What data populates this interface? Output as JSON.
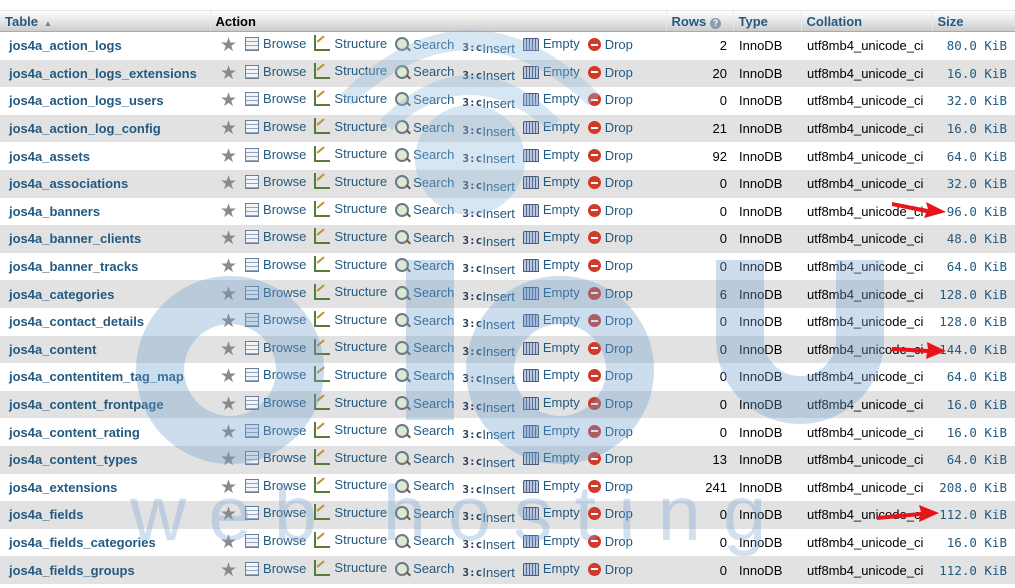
{
  "header": {
    "table_label": "Table",
    "action_label": "Action",
    "rows_label": "Rows",
    "type_label": "Type",
    "collation_label": "Collation",
    "size_label": "Size"
  },
  "actions": {
    "browse": "Browse",
    "structure": "Structure",
    "search": "Search",
    "insert": "Insert",
    "empty": "Empty",
    "drop": "Drop"
  },
  "rows": [
    {
      "name": "jos4a_action_logs",
      "rows": "2",
      "type": "InnoDB",
      "collation": "utf8mb4_unicode_ci",
      "size": "80.0 KiB"
    },
    {
      "name": "jos4a_action_logs_extensions",
      "rows": "20",
      "type": "InnoDB",
      "collation": "utf8mb4_unicode_ci",
      "size": "16.0 KiB"
    },
    {
      "name": "jos4a_action_logs_users",
      "rows": "0",
      "type": "InnoDB",
      "collation": "utf8mb4_unicode_ci",
      "size": "32.0 KiB"
    },
    {
      "name": "jos4a_action_log_config",
      "rows": "21",
      "type": "InnoDB",
      "collation": "utf8mb4_unicode_ci",
      "size": "16.0 KiB"
    },
    {
      "name": "jos4a_assets",
      "rows": "92",
      "type": "InnoDB",
      "collation": "utf8mb4_unicode_ci",
      "size": "64.0 KiB"
    },
    {
      "name": "jos4a_associations",
      "rows": "0",
      "type": "InnoDB",
      "collation": "utf8mb4_unicode_ci",
      "size": "32.0 KiB"
    },
    {
      "name": "jos4a_banners",
      "rows": "0",
      "type": "InnoDB",
      "collation": "utf8mb4_unicode_ci",
      "size": "96.0 KiB"
    },
    {
      "name": "jos4a_banner_clients",
      "rows": "0",
      "type": "InnoDB",
      "collation": "utf8mb4_unicode_ci",
      "size": "48.0 KiB"
    },
    {
      "name": "jos4a_banner_tracks",
      "rows": "0",
      "type": "InnoDB",
      "collation": "utf8mb4_unicode_ci",
      "size": "64.0 KiB"
    },
    {
      "name": "jos4a_categories",
      "rows": "6",
      "type": "InnoDB",
      "collation": "utf8mb4_unicode_ci",
      "size": "128.0 KiB"
    },
    {
      "name": "jos4a_contact_details",
      "rows": "0",
      "type": "InnoDB",
      "collation": "utf8mb4_unicode_ci",
      "size": "128.0 KiB"
    },
    {
      "name": "jos4a_content",
      "rows": "0",
      "type": "InnoDB",
      "collation": "utf8mb4_unicode_ci",
      "size": "144.0 KiB"
    },
    {
      "name": "jos4a_contentitem_tag_map",
      "rows": "0",
      "type": "InnoDB",
      "collation": "utf8mb4_unicode_ci",
      "size": "64.0 KiB"
    },
    {
      "name": "jos4a_content_frontpage",
      "rows": "0",
      "type": "InnoDB",
      "collation": "utf8mb4_unicode_ci",
      "size": "16.0 KiB"
    },
    {
      "name": "jos4a_content_rating",
      "rows": "0",
      "type": "InnoDB",
      "collation": "utf8mb4_unicode_ci",
      "size": "16.0 KiB"
    },
    {
      "name": "jos4a_content_types",
      "rows": "13",
      "type": "InnoDB",
      "collation": "utf8mb4_unicode_ci",
      "size": "64.0 KiB"
    },
    {
      "name": "jos4a_extensions",
      "rows": "241",
      "type": "InnoDB",
      "collation": "utf8mb4_unicode_ci",
      "size": "208.0 KiB"
    },
    {
      "name": "jos4a_fields",
      "rows": "0",
      "type": "InnoDB",
      "collation": "utf8mb4_unicode_ci",
      "size": "112.0 KiB"
    },
    {
      "name": "jos4a_fields_categories",
      "rows": "0",
      "type": "InnoDB",
      "collation": "utf8mb4_unicode_ci",
      "size": "16.0 KiB"
    },
    {
      "name": "jos4a_fields_groups",
      "rows": "0",
      "type": "InnoDB",
      "collation": "utf8mb4_unicode_ci",
      "size": "112.0 KiB"
    }
  ],
  "watermark": {
    "brand": "atcu",
    "tagline": "web hosting"
  },
  "colors": {
    "link": "#235a81",
    "row_alt": "#e2e2e2",
    "arrow": "#e8141b",
    "drop": "#d03a2a"
  }
}
